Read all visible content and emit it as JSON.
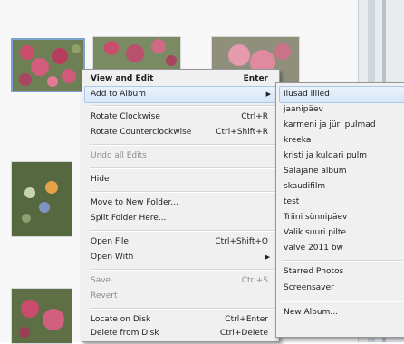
{
  "menu": {
    "items": [
      {
        "label": "View and Edit",
        "shortcut": "Enter"
      },
      {
        "label": "Add to Album",
        "shortcut": ""
      },
      {
        "label": "Rotate Clockwise",
        "shortcut": "Ctrl+R"
      },
      {
        "label": "Rotate Counterclockwise",
        "shortcut": "Ctrl+Shift+R"
      },
      {
        "label": "Undo all Edits",
        "shortcut": ""
      },
      {
        "label": "Hide",
        "shortcut": ""
      },
      {
        "label": "Move to New Folder...",
        "shortcut": ""
      },
      {
        "label": "Split Folder Here...",
        "shortcut": ""
      },
      {
        "label": "Open File",
        "shortcut": "Ctrl+Shift+O"
      },
      {
        "label": "Open With",
        "shortcut": ""
      },
      {
        "label": "Save",
        "shortcut": "Ctrl+S"
      },
      {
        "label": "Revert",
        "shortcut": ""
      },
      {
        "label": "Locate on Disk",
        "shortcut": "Ctrl+Enter"
      },
      {
        "label": "Delete from Disk",
        "shortcut": "Ctrl+Delete"
      }
    ]
  },
  "submenu": {
    "albums": [
      "Ilusad lilled",
      "jaanipäev",
      "karmeni ja jüri pulmad",
      "kreeka",
      "kristi ja kuldari pulm",
      "Salajane album",
      "skaudifilm",
      "test",
      "Triini sünnipäev",
      "Valik suuri pilte",
      "valve 2011 bw"
    ],
    "special": [
      "Starred Photos",
      "Screensaver"
    ],
    "new_album": "New Album..."
  },
  "colors": {
    "menu_bg": "#f0f0f0",
    "highlight": "#d6e6f8",
    "highlight_border": "#a8c8ec",
    "disabled_text": "#8d8d8d"
  }
}
